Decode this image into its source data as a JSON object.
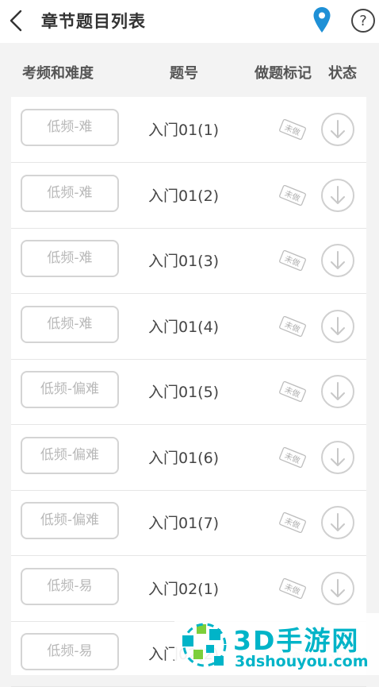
{
  "header": {
    "title": "章节题目列表"
  },
  "columns": {
    "difficulty": "考频和难度",
    "number": "题号",
    "mark": "做题标记",
    "status": "状态"
  },
  "stamp_text": "未做",
  "rows": [
    {
      "tag": "低频-难",
      "qno": "入门01(1)"
    },
    {
      "tag": "低频-难",
      "qno": "入门01(2)"
    },
    {
      "tag": "低频-难",
      "qno": "入门01(3)"
    },
    {
      "tag": "低频-难",
      "qno": "入门01(4)"
    },
    {
      "tag": "低频-偏难",
      "qno": "入门01(5)"
    },
    {
      "tag": "低频-偏难",
      "qno": "入门01(6)"
    },
    {
      "tag": "低频-偏难",
      "qno": "入门01(7)"
    },
    {
      "tag": "低频-易",
      "qno": "入门02(1)"
    },
    {
      "tag": "低频-易",
      "qno": "入门02(2)"
    }
  ],
  "watermark": {
    "brand": "3D手游网",
    "url": "3dshouyou.com"
  },
  "colors": {
    "accent": "#1e90d6",
    "watermark": "#00b4c8"
  },
  "icons": [
    "back-icon",
    "location-pin-icon",
    "help-icon",
    "download-icon"
  ]
}
